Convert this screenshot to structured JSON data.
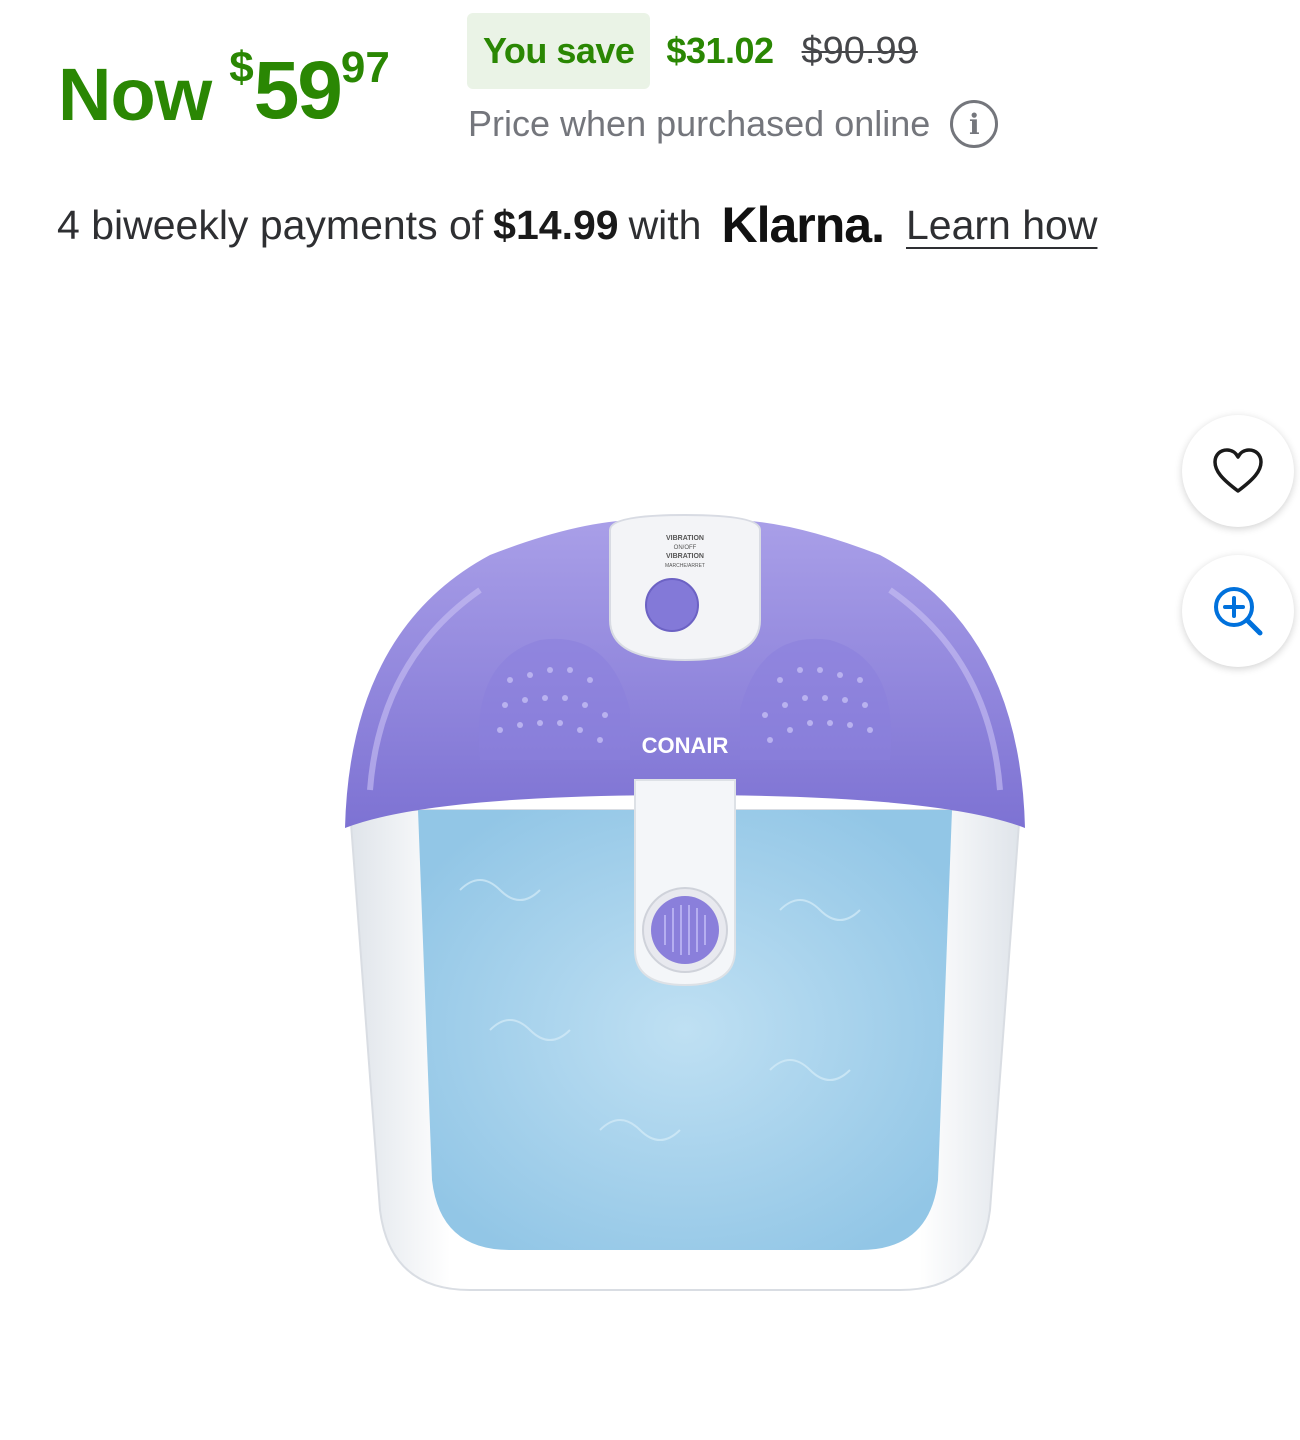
{
  "price": {
    "now_label": "Now",
    "currency": "$",
    "dollars": "59",
    "cents": "97",
    "you_save_label": "You save",
    "save_amount": "$31.02",
    "was_price": "$90.99",
    "online_note": "Price when purchased online",
    "info_glyph": "i"
  },
  "financing": {
    "prefix": "4 biweekly payments of",
    "amount": "$14.99",
    "with": "with",
    "provider": "Klarna.",
    "learn_link": "Learn how"
  },
  "product_image": {
    "brand_text": "CONAIR",
    "button_text_1": "VIBRATION",
    "button_text_2": "ON/OFF",
    "button_text_3": "VIBRATION",
    "button_text_4": "MARCHE/ARRET"
  },
  "actions": {
    "favorite_icon": "heart-icon",
    "zoom_icon": "zoom-in-icon"
  },
  "colors": {
    "price_green": "#2a8703",
    "badge_bg": "#eaf3e6",
    "lid_purple": "#7f74d6",
    "water_blue": "#a9d4ee"
  }
}
